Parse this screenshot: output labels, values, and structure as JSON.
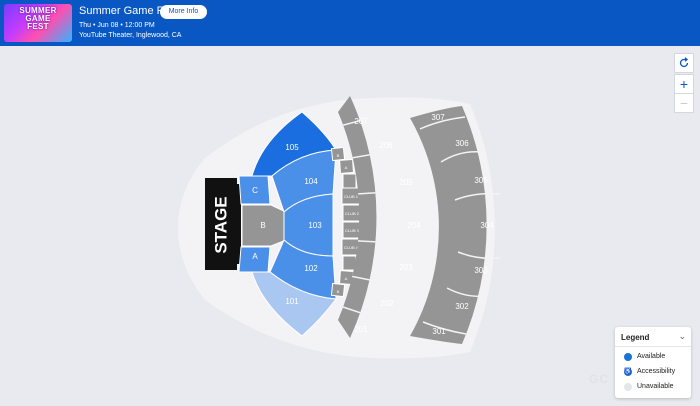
{
  "event": {
    "title": "Summer Game Fest",
    "more_info_label": "More Info",
    "date": "Thu • Jun 08 • 12:00 PM",
    "venue": "YouTube Theater, Inglewood, CA",
    "thumbnail_text": "SUMMER GAME FEST"
  },
  "map_controls": {
    "reset_icon": "reset-icon",
    "zoom_in_icon": "plus-icon",
    "zoom_out_icon": "minus-icon"
  },
  "stage": {
    "label": "STAGE"
  },
  "floor": {
    "A": "A",
    "B": "B",
    "C": "C"
  },
  "sections_100": {
    "s101": "101",
    "s102": "102",
    "s103": "103",
    "s104": "104",
    "s105": "105"
  },
  "boxes": {
    "box_lower": [
      "A",
      "B"
    ],
    "box_upper": [
      "B",
      "A"
    ],
    "clubs": [
      "CLUB 1",
      "CLUB 2",
      "CLUB 3",
      "CLUB 4"
    ]
  },
  "sections_200": {
    "s201": "201",
    "s202": "202",
    "s203": "203",
    "s204": "204",
    "s205": "205",
    "s206": "206",
    "s207": "207"
  },
  "sections_300": {
    "s301": "301",
    "s302": "302",
    "s303": "303",
    "s304": "304",
    "s305": "305",
    "s306": "306",
    "s307": "307"
  },
  "legend": {
    "title": "Legend",
    "items": [
      {
        "label": "Available",
        "color": "#1a73d6"
      },
      {
        "label": "Accessibility",
        "color": "#1a73d6",
        "icon": "wheelchair-icon"
      },
      {
        "label": "Unavailable",
        "color": "#e4e6ea"
      }
    ]
  },
  "colors": {
    "header": "#0857c3",
    "available_dark": "#1a6ee0",
    "available_mid": "#4a8fe8",
    "available_light": "#a9c7f1",
    "unavailable": "#959595"
  },
  "watermark": "GC"
}
